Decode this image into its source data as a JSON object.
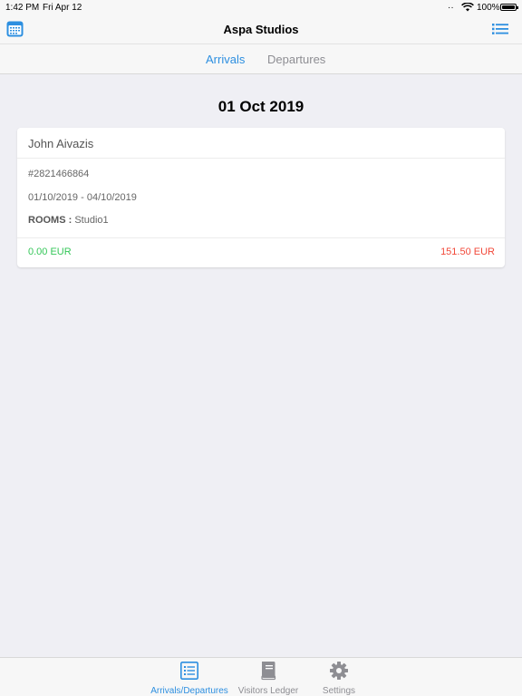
{
  "status_bar": {
    "time": "1:42 PM",
    "date": "Fri Apr 12",
    "battery": "100%"
  },
  "nav": {
    "title": "Aspa Studios",
    "left_icon": "calendar-icon",
    "right_icon": "list-icon"
  },
  "segment": {
    "tabs": [
      {
        "label": "Arrivals",
        "selected": true
      },
      {
        "label": "Departures",
        "selected": false
      }
    ]
  },
  "main": {
    "date_heading": "01 Oct 2019",
    "bookings": [
      {
        "guest_name": "John Aivazis",
        "booking_id": "#2821466864",
        "date_range": "01/10/2019 - 04/10/2019",
        "rooms_label": "ROOMS :",
        "rooms_value": "Studio1",
        "paid": "0.00 EUR",
        "due": "151.50 EUR"
      }
    ]
  },
  "tab_bar": {
    "items": [
      {
        "label": "Arrivals/Departures",
        "icon": "list-icon",
        "selected": true
      },
      {
        "label": "Visitors Ledger",
        "icon": "book-icon",
        "selected": false
      },
      {
        "label": "Settings",
        "icon": "gear-icon",
        "selected": false
      }
    ]
  },
  "colors": {
    "accent": "#2d8fe0",
    "paid": "#35c759",
    "due": "#f2493a",
    "background": "#efeff4"
  }
}
